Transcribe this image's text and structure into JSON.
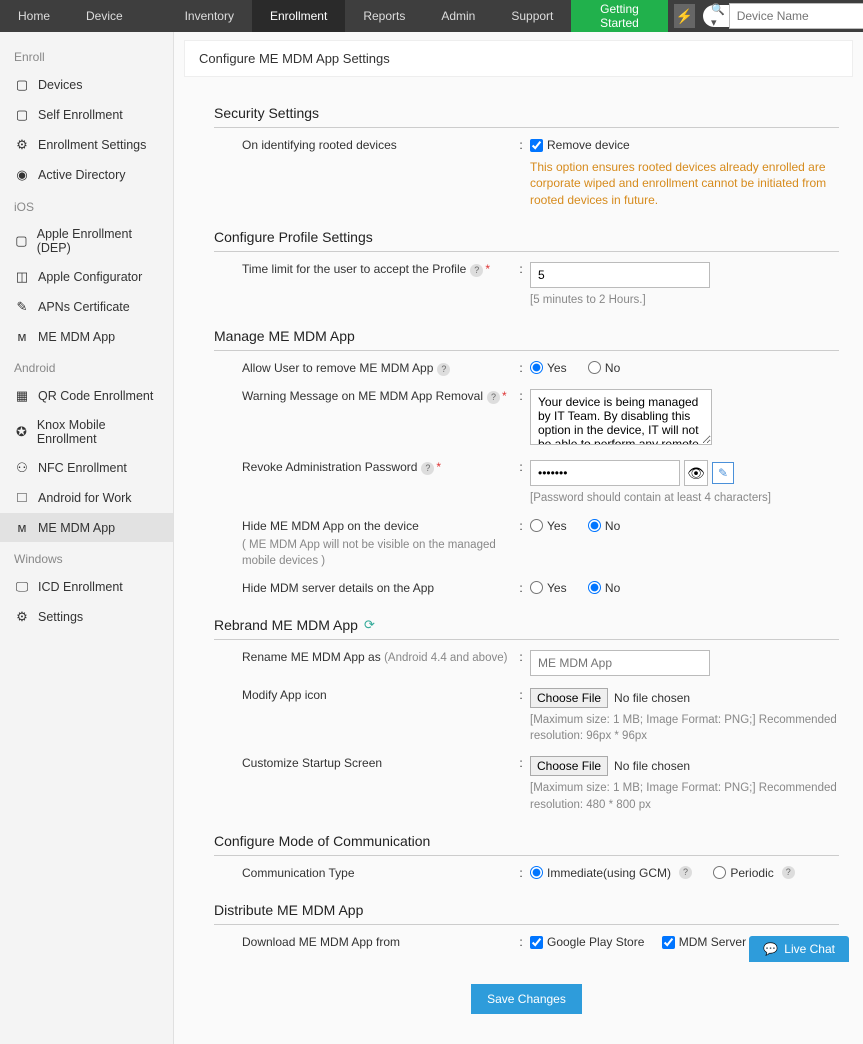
{
  "topnav": {
    "items": [
      "Home",
      "Device Mgmt",
      "Inventory",
      "Enrollment",
      "Reports",
      "Admin",
      "Support"
    ],
    "active": "Enrollment",
    "getting_started": "Getting Started",
    "search_placeholder": "Device Name"
  },
  "sidebar": {
    "groups": [
      {
        "title": "Enroll",
        "items": [
          {
            "icon": "▢",
            "label": "Devices"
          },
          {
            "icon": "▢",
            "label": "Self Enrollment"
          },
          {
            "icon": "⚙",
            "label": "Enrollment Settings"
          },
          {
            "icon": "◉",
            "label": "Active Directory"
          }
        ]
      },
      {
        "title": "iOS",
        "items": [
          {
            "icon": "▢",
            "label": "Apple Enrollment (DEP)"
          },
          {
            "icon": "◫",
            "label": "Apple Configurator"
          },
          {
            "icon": "✎",
            "label": "APNs Certificate"
          },
          {
            "icon": "ᴍ",
            "label": "ME MDM App"
          }
        ]
      },
      {
        "title": "Android",
        "items": [
          {
            "icon": "▦",
            "label": "QR Code Enrollment"
          },
          {
            "icon": "✪",
            "label": "Knox Mobile Enrollment"
          },
          {
            "icon": "⚇",
            "label": "NFC Enrollment"
          },
          {
            "icon": "🞎",
            "label": "Android for Work"
          },
          {
            "icon": "ᴍ",
            "label": "ME MDM App"
          }
        ]
      },
      {
        "title": "Windows",
        "items": [
          {
            "icon": "🖵",
            "label": "ICD Enrollment"
          },
          {
            "icon": "⚙",
            "label": "Settings"
          }
        ]
      }
    ]
  },
  "page": {
    "title": "Configure ME MDM App Settings",
    "sections": {
      "security": {
        "title": "Security Settings",
        "rooted_label": "On identifying rooted devices",
        "remove_device": "Remove device",
        "rooted_note": "This option ensures rooted devices already enrolled are corporate wiped and enrollment cannot be initiated from rooted devices in future."
      },
      "profile": {
        "title": "Configure Profile Settings",
        "time_limit_label": "Time limit for the user to accept the Profile",
        "time_limit_value": "5",
        "time_limit_hint": "[5 minutes to 2 Hours.]"
      },
      "manage": {
        "title": "Manage ME MDM App",
        "allow_remove_label": "Allow User to remove ME MDM App",
        "warning_label": "Warning Message on ME MDM App Removal",
        "warning_value": "Your device is being managed by IT Team. By disabling this option in the device, IT will not be able to perform any remote management activities on your device.",
        "revoke_label": "Revoke Administration Password",
        "revoke_value": "•••••••",
        "revoke_hint": "[Password should contain at least 4 characters]",
        "hide_app_label": "Hide ME MDM App on the device",
        "hide_app_sub": "( ME MDM App will not be visible on the managed mobile devices )",
        "hide_server_label": "Hide MDM server details on the App",
        "yes": "Yes",
        "no": "No"
      },
      "rebrand": {
        "title": "Rebrand ME MDM App",
        "rename_label": "Rename ME MDM App as",
        "rename_suffix": "(Android 4.4 and above)",
        "rename_placeholder": "ME MDM App",
        "modify_icon_label": "Modify App icon",
        "choose_file": "Choose File",
        "no_file": "No file chosen",
        "icon_hint": "[Maximum size: 1 MB; Image Format: PNG;] Recommended resolution: 96px * 96px",
        "startup_label": "Customize Startup Screen",
        "startup_hint": "[Maximum size: 1 MB; Image Format: PNG;] Recommended resolution: 480 * 800 px"
      },
      "comm": {
        "title": "Configure Mode of Communication",
        "type_label": "Communication Type",
        "immediate": "Immediate(using GCM)",
        "periodic": "Periodic"
      },
      "distribute": {
        "title": "Distribute ME MDM App",
        "download_label": "Download ME MDM App from",
        "play_store": "Google Play Store",
        "mdm_server": "MDM Server"
      }
    },
    "save": "Save Changes"
  },
  "live_chat": "Live Chat"
}
